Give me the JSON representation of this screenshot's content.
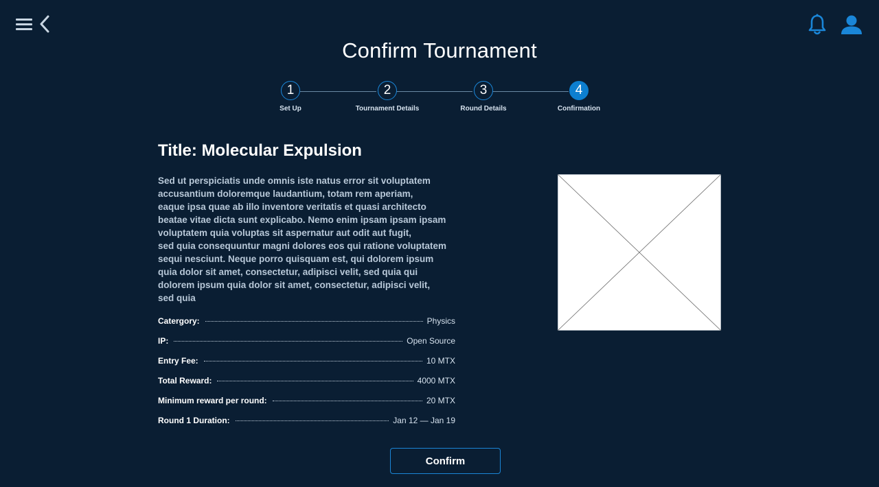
{
  "header": {
    "title": "Confirm Tournament",
    "left_icons": [
      "menu-icon",
      "back-icon"
    ],
    "right_icons": [
      "bell-icon",
      "user-icon"
    ]
  },
  "stepper": {
    "steps": [
      {
        "number": "1",
        "label": "Set Up",
        "active": false
      },
      {
        "number": "2",
        "label": "Tournament Details",
        "active": false
      },
      {
        "number": "3",
        "label": "Round Details",
        "active": false
      },
      {
        "number": "4",
        "label": "Confirmation",
        "active": true
      }
    ]
  },
  "tournament": {
    "title": "Title: Molecular Expulsion",
    "description": "Sed ut perspiciatis unde omnis iste natus error sit voluptatem\naccusantium doloremque laudantium, totam rem aperiam,\neaque ipsa quae ab illo inventore veritatis et quasi architecto\nbeatae vitae dicta sunt explicabo. Nemo enim ipsam ipsam ipsam\nvoluptatem quia voluptas sit aspernatur aut odit aut fugit,\nsed quia consequuntur magni dolores eos qui ratione voluptatem\nsequi nesciunt. Neque porro quisquam est, qui dolorem ipsum\nquia dolor sit amet, consectetur, adipisci velit, sed quia qui\ndolorem ipsum quia dolor sit amet, consectetur, adipisci velit,\nsed quia",
    "details": [
      {
        "label": "Catergory:",
        "value": "Physics"
      },
      {
        "label": "IP:",
        "value": "Open Source"
      },
      {
        "label": "Entry Fee:",
        "value": "10 MTX"
      },
      {
        "label": "Total Reward:",
        "value": "4000 MTX"
      },
      {
        "label": "Minimum reward per round:",
        "value": "20 MTX"
      },
      {
        "label": "Round 1 Duration:",
        "value": "Jan 12 — Jan 19"
      }
    ]
  },
  "actions": {
    "confirm_label": "Confirm"
  },
  "colors": {
    "background": "#0a1e33",
    "accent": "#0d7fd0",
    "icon_blue": "#1a86d8"
  }
}
